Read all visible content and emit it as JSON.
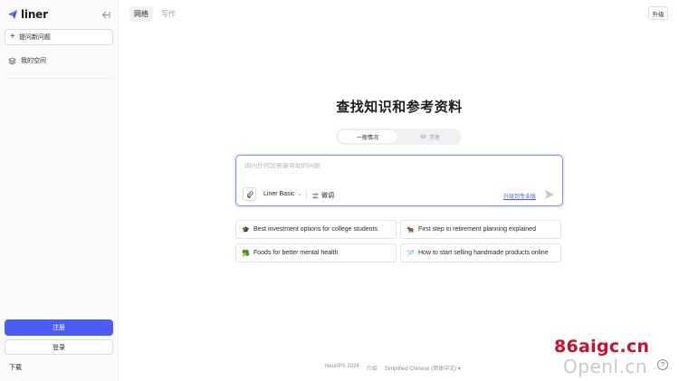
{
  "app": {
    "logo_text": "liner"
  },
  "sidebar": {
    "new_question": "提问新问题",
    "my_space": "我的空间",
    "signup": "注册",
    "login": "登录",
    "download": "下载"
  },
  "top_tabs": [
    {
      "label": "网络",
      "active": true
    },
    {
      "label": "写作",
      "active": false
    }
  ],
  "upgrade_button": "升级",
  "main": {
    "headline": "查找知识和参考资料",
    "modes": [
      {
        "label": "一般情况",
        "active": true
      },
      {
        "label": "学者",
        "active": false
      }
    ],
    "search": {
      "placeholder": "询问任何您需要帮助的问题",
      "model": "Liner Basic",
      "tune_label": "微调",
      "upgrade_link": "升级到专业版"
    },
    "suggestions": [
      {
        "icon": "🎓",
        "text": "Best investment options for college students"
      },
      {
        "icon": "🐂",
        "text": "First step in retirement planning explained"
      },
      {
        "icon": "🥦",
        "text": "Foods for better mental health"
      },
      {
        "icon": "🪡",
        "text": "How to start selling handmade products online"
      }
    ]
  },
  "footer": {
    "conference": "NeurIPS 2024",
    "about": "介绍",
    "language": "Simplified Chinese (简体中文)"
  },
  "help": "?",
  "watermark": {
    "line1": "86aigc.cn",
    "line2": "Openl.cn"
  },
  "colors": {
    "accent": "#4a5ef5",
    "focus_border": "#7b8cf8"
  }
}
